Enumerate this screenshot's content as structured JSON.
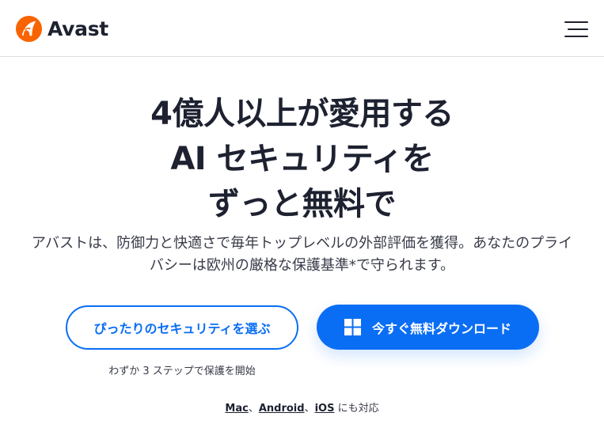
{
  "header": {
    "brand": "Avast",
    "logo_icon": "avast-logo-icon",
    "menu_icon": "hamburger-menu-icon"
  },
  "hero": {
    "title_lines": [
      "4億人以上が愛用する",
      "AI セキュリティを",
      "ずっと無料で"
    ],
    "description_lines": [
      "アバストは、防御力と快適さで毎年トップレベルの外部評価を獲得。あなたのプライ",
      "バシーは欧州の厳格な保護基準*で守られます。"
    ]
  },
  "cta": {
    "choose_label": "ぴったりのセキュリティを選ぶ",
    "download_label": "今すぐ無料ダウンロード",
    "download_icon": "windows-icon",
    "steps_note": "わずか 3 ステップで保護を開始"
  },
  "platforms": {
    "links": [
      "Mac",
      "Android",
      "iOS"
    ],
    "separator": "、",
    "suffix": " にも対応"
  },
  "colors": {
    "brand_orange": "#f96300",
    "accent_blue": "#0a6ef5",
    "text_dark": "#1d2130"
  }
}
